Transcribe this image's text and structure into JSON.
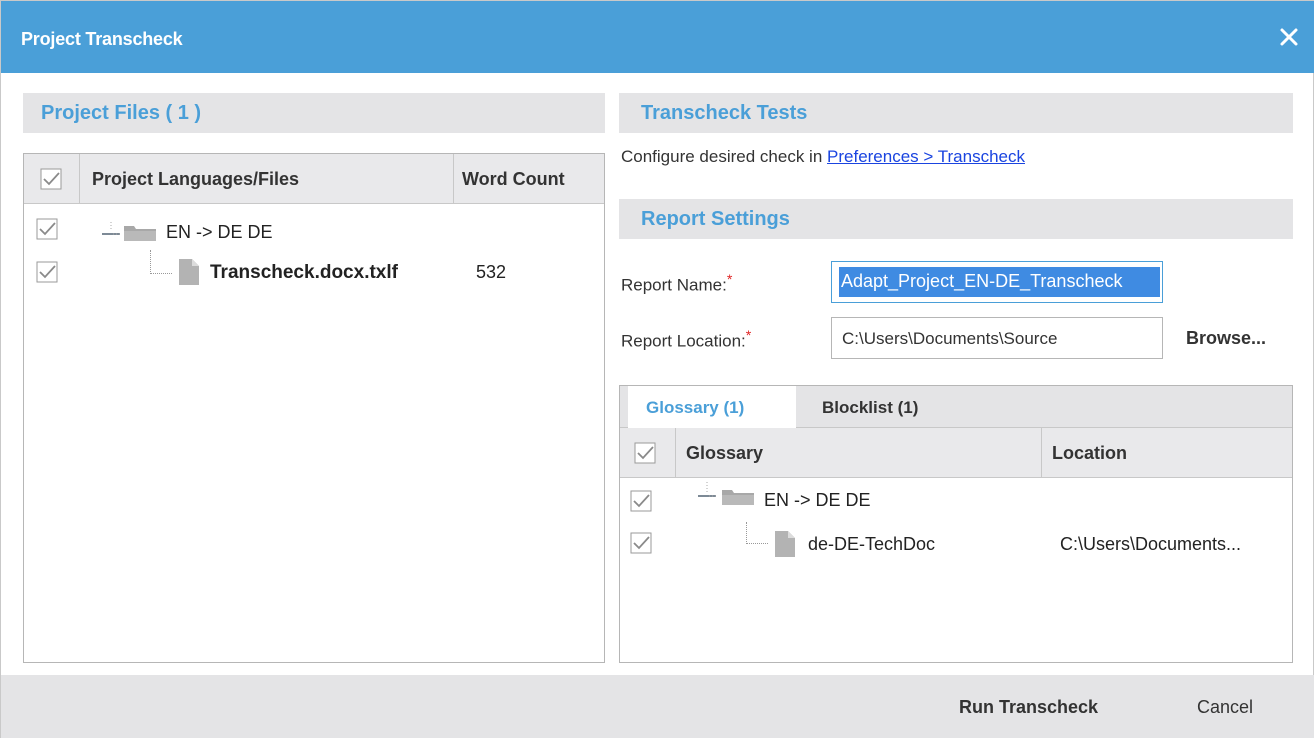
{
  "window": {
    "title": "Project Transcheck"
  },
  "project_files": {
    "header": "Project Files ( 1 )",
    "columns": {
      "files": "Project Languages/Files",
      "word_count": "Word Count"
    },
    "rows": [
      {
        "label": "EN -> DE DE",
        "word_count": ""
      },
      {
        "label": "Transcheck.docx.txlf",
        "word_count": "532"
      }
    ]
  },
  "tests": {
    "header": "Transcheck Tests",
    "description": "Configure desired check in ",
    "link": "Preferences > Transcheck"
  },
  "report": {
    "header": "Report Settings",
    "name_label": "Report Name:",
    "name_value": "Adapt_Project_EN-DE_Transcheck",
    "location_label": "Report Location:",
    "location_value": "C:\\Users\\Documents\\Source",
    "required_mark": "*",
    "browse_label": "Browse..."
  },
  "resources": {
    "tabs": [
      "Glossary (1)",
      "Blocklist (1)"
    ],
    "active_tab": 0,
    "columns": {
      "name": "Glossary",
      "location": "Location"
    },
    "rows": [
      {
        "label": "EN -> DE DE",
        "location": ""
      },
      {
        "label": "de-DE-TechDoc",
        "location": "C:\\Users\\Documents..."
      }
    ]
  },
  "footer": {
    "run_label": "Run Transcheck",
    "cancel_label": "Cancel"
  },
  "colors": {
    "accent": "#4a9fd8",
    "link": "#1a44e0",
    "required": "#e02525",
    "selection": "#3f8be2"
  },
  "icons": {
    "close": "close-icon",
    "checkbox": "checkbox-checked-icon",
    "folder": "folder-icon",
    "file": "file-icon",
    "tree_toggle": "collapse-minus-icon"
  }
}
